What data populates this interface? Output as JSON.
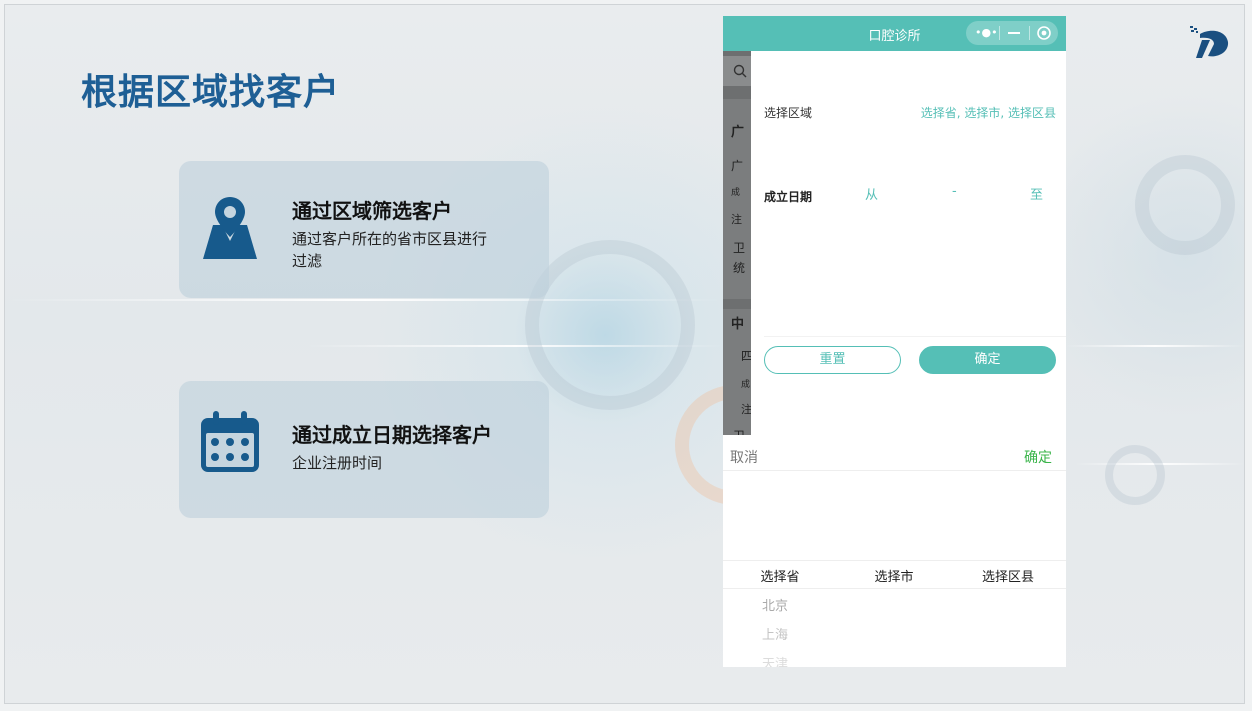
{
  "slide": {
    "title": "根据区域找客户",
    "cards": [
      {
        "title": "通过区域筛选客户",
        "desc": "通过客户所在的省市区县进行过滤",
        "icon": "map-pin-icon"
      },
      {
        "title": "通过成立日期选择客户",
        "desc": "企业注册时间",
        "icon": "calendar-icon"
      }
    ]
  },
  "phone": {
    "title": "口腔诊所",
    "capsule_icons": [
      "more-dots-icon",
      "minimize-icon",
      "close-circle-icon"
    ],
    "background_fragments": [
      "广",
      "广",
      "成",
      "注",
      "卫",
      "统",
      "中",
      "四",
      "成",
      "注",
      "卫"
    ],
    "filter": {
      "region_label": "选择区域",
      "region_placeholder": "选择省, 选择市, 选择区县",
      "date_label": "成立日期",
      "date_from": "从",
      "date_sep": "-",
      "date_to": "至",
      "reset_label": "重置",
      "confirm_label": "确定"
    },
    "picker": {
      "cancel_label": "取消",
      "confirm_label": "确定",
      "columns": [
        "选择省",
        "选择市",
        "选择区县"
      ],
      "provinces": [
        "北京",
        "上海",
        "天津"
      ]
    }
  },
  "colors": {
    "title_blue": "#1e5f95",
    "icon_blue": "#175a8c",
    "accent_teal": "#55bfb6",
    "confirm_green": "#3ab44a"
  }
}
